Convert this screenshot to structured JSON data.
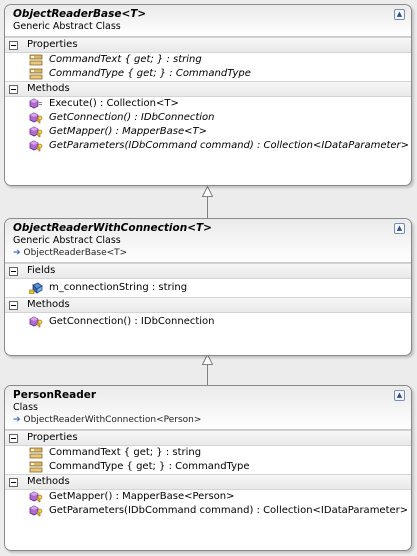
{
  "classes": [
    {
      "name": "ObjectReaderBase<T>",
      "stereotype": "Generic Abstract Class",
      "base": "",
      "properties_label": "Properties",
      "properties": [
        {
          "text": "CommandText { get; } : string",
          "icon": "property-icon"
        },
        {
          "text": "CommandType { get; } : CommandType",
          "icon": "property-icon"
        }
      ],
      "methods_label": "Methods",
      "methods": [
        {
          "text": "Execute() : Collection<T>",
          "icon": "method-icon"
        },
        {
          "text": "GetConnection() : IDbConnection",
          "icon": "protected-method-icon"
        },
        {
          "text": "GetMapper() : MapperBase<T>",
          "icon": "protected-method-icon"
        },
        {
          "text": "GetParameters(IDbCommand  command) : Collection<IDataParameter>",
          "icon": "protected-method-icon"
        }
      ]
    },
    {
      "name": "ObjectReaderWithConnection<T>",
      "stereotype": "Generic Abstract Class",
      "base": "ObjectReaderBase<T>",
      "fields_label": "Fields",
      "fields": [
        {
          "text": "m_connectionString : string",
          "icon": "private-field-icon"
        }
      ],
      "methods_label": "Methods",
      "methods": [
        {
          "text": "GetConnection() : IDbConnection",
          "icon": "protected-method-icon"
        }
      ]
    },
    {
      "name": "PersonReader",
      "stereotype": "Class",
      "base": "ObjectReaderWithConnection<Person>",
      "properties_label": "Properties",
      "properties": [
        {
          "text": "CommandText { get; } : string",
          "icon": "property-icon"
        },
        {
          "text": "CommandType { get; } : CommandType",
          "icon": "property-icon"
        }
      ],
      "methods_label": "Methods",
      "methods": [
        {
          "text": "GetMapper() : MapperBase<Person>",
          "icon": "protected-method-icon"
        },
        {
          "text": "GetParameters(IDbCommand  command) : Collection<IDataParameter>",
          "icon": "protected-method-icon"
        }
      ]
    }
  ],
  "colors": {
    "background": "#ececec",
    "box_border": "#8a8a8a",
    "accent": "#3a6ab4"
  }
}
